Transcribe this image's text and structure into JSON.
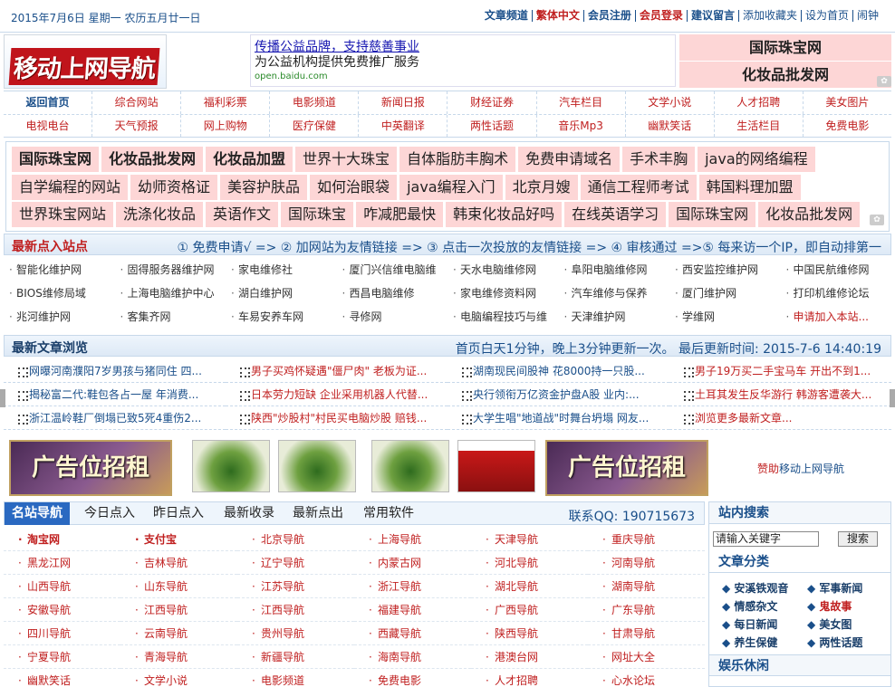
{
  "topbar": {
    "date": "2015年7月6日 星期一 农历五月廿一日",
    "links": [
      {
        "label": "文章频道",
        "color": "#1a4f8a",
        "bold": true
      },
      {
        "label": "繁体中文",
        "color": "#c02020",
        "bold": true
      },
      {
        "label": "会员注册",
        "color": "#1a4f8a",
        "bold": true
      },
      {
        "label": "会员登录",
        "color": "#c02020",
        "bold": true
      },
      {
        "label": "建议留言",
        "color": "#1a4f8a",
        "bold": true
      },
      {
        "label": "添加收藏夹",
        "color": "#1a4f8a",
        "bold": false
      },
      {
        "label": "设为首页",
        "color": "#1a4f8a",
        "bold": false
      },
      {
        "label": "闹钟",
        "color": "#1a4f8a",
        "bold": false
      }
    ]
  },
  "logo": {
    "text": "移动上网导航"
  },
  "header_ad": {
    "line1": "传播公益品牌，支持慈善事业",
    "line2": "为公益机构提供免费推广服务",
    "line3": "open.baidu.com"
  },
  "header_right": [
    "国际珠宝网",
    "化妆品批发网"
  ],
  "nav": {
    "row1": [
      "返回首页",
      "综合网站",
      "福利彩票",
      "电影频道",
      "新闻日报",
      "财经证券",
      "汽车栏目",
      "文学小说",
      "人才招聘",
      "美女图片"
    ],
    "row2": [
      "电视电台",
      "天气预报",
      "网上购物",
      "医疗保健",
      "中英翻译",
      "两性话题",
      "音乐Mp3",
      "幽默笑话",
      "生活栏目",
      "免费电影"
    ]
  },
  "keywords": {
    "row1": [
      "国际珠宝网",
      "化妆品批发网",
      "化妆品加盟",
      "世界十大珠宝",
      "自体脂肪丰胸术",
      "免费申请域名",
      "手术丰胸",
      "java的网络编程"
    ],
    "row2": [
      "自学编程的网站",
      "幼师资格证",
      "美容护肤品",
      "如何治眼袋",
      "java编程入门",
      "北京月嫂",
      "通信工程师考试",
      "韩国料理加盟"
    ],
    "row3": [
      "世界珠宝网站",
      "洗涤化妆品",
      "英语作文",
      "国际珠宝",
      "咋减肥最快",
      "韩束化妆品好吗",
      "在线英语学习",
      "国际珠宝网",
      "化妆品批发网"
    ]
  },
  "latest_sites": {
    "title": "最新点入站点",
    "info": "① 免费申请√ => ② 加网站为友情链接 => ③ 点击一次投放的友情链接 => ④ 审核通过 =>⑤ 每来访一个IP，即自动排第一",
    "items": [
      "智能化维护网",
      "固得服务器维护网",
      "家电维修社",
      "厦门兴信维电脑维",
      "天水电脑维修网",
      "阜阳电脑维修网",
      "西安监控维护网",
      "中国民航维修网",
      "BIOS维修局域",
      "上海电脑维护中心",
      "湖白维护网",
      "西昌电脑维修",
      "家电维修资料网",
      "汽车维修与保养",
      "厦门维护网",
      "打印机维修论坛",
      "兆河维护网",
      "客集齐网",
      "车易安养车网",
      "寻修网",
      "电脑编程技巧与维",
      "天津维护网",
      "学维网",
      "申请加入本站..."
    ]
  },
  "latest_articles": {
    "title": "最新文章浏览",
    "info": "首页白天1分钟，晚上3分钟更新一次。 最后更新时间: 2015-7-6 14:40:19",
    "items": [
      "网曝河南濮阳7岁男孩与猪同住 四...",
      "男子买鸡怀疑遇\"僵尸肉\" 老板为证...",
      "湖南现民间股神 花8000持一只股...",
      "男子19万买二手宝马车 开出不到1...",
      "揭秘富二代:鞋包各占一屋 年消费...",
      "日本劳力短缺 企业采用机器人代替...",
      "央行领衔万亿资金护盘A股 业内:...",
      "土耳其发生反华游行 韩游客遭袭大...",
      "浙江温岭鞋厂倒塌已致5死4重伤2...",
      "陕西\"炒股村\"村民买电脑炒股 赔钱...",
      "大学生唱\"地道战\"时舞台坍塌 网友...",
      "浏览更多最新文章..."
    ]
  },
  "ads": {
    "banner_left": "广告位招租",
    "banner_right": "广告位招租",
    "sponsor_prefix": "赞助",
    "sponsor_suffix": "移动上网导航"
  },
  "famous": {
    "tabs": [
      "名站导航",
      "今日点入",
      "昨日点入",
      "最新收录",
      "最新点出",
      "常用软件"
    ],
    "qq": "联系QQ: 190715673",
    "items": [
      "淘宝网",
      "支付宝",
      "北京导航",
      "上海导航",
      "天津导航",
      "重庆导航",
      "黑龙江网",
      "吉林导航",
      "辽宁导航",
      "内蒙古网",
      "河北导航",
      "河南导航",
      "山西导航",
      "山东导航",
      "江苏导航",
      "浙江导航",
      "湖北导航",
      "湖南导航",
      "安徽导航",
      "江西导航",
      "江西导航",
      "福建导航",
      "广西导航",
      "广东导航",
      "四川导航",
      "云南导航",
      "贵州导航",
      "西藏导航",
      "陕西导航",
      "甘肃导航",
      "宁夏导航",
      "青海导航",
      "新疆导航",
      "海南导航",
      "港澳台网",
      "网址大全",
      "幽默笑话",
      "文学小说",
      "电影频道",
      "免费电影",
      "人才招聘",
      "心水论坛"
    ]
  },
  "sidebar": {
    "search_title": "站内搜索",
    "search_placeholder": "请输入关键字",
    "search_button": "搜索",
    "categories_title": "文章分类",
    "categories": [
      {
        "label": "安溪铁观音",
        "red": false
      },
      {
        "label": "军事新闻",
        "red": false
      },
      {
        "label": "情感杂文",
        "red": false
      },
      {
        "label": "鬼故事",
        "red": true
      },
      {
        "label": "每日新闻",
        "red": false
      },
      {
        "label": "美女图",
        "red": false
      },
      {
        "label": "养生保健",
        "red": false
      },
      {
        "label": "两性话题",
        "red": false
      }
    ],
    "leisure_title": "娱乐休闲"
  }
}
